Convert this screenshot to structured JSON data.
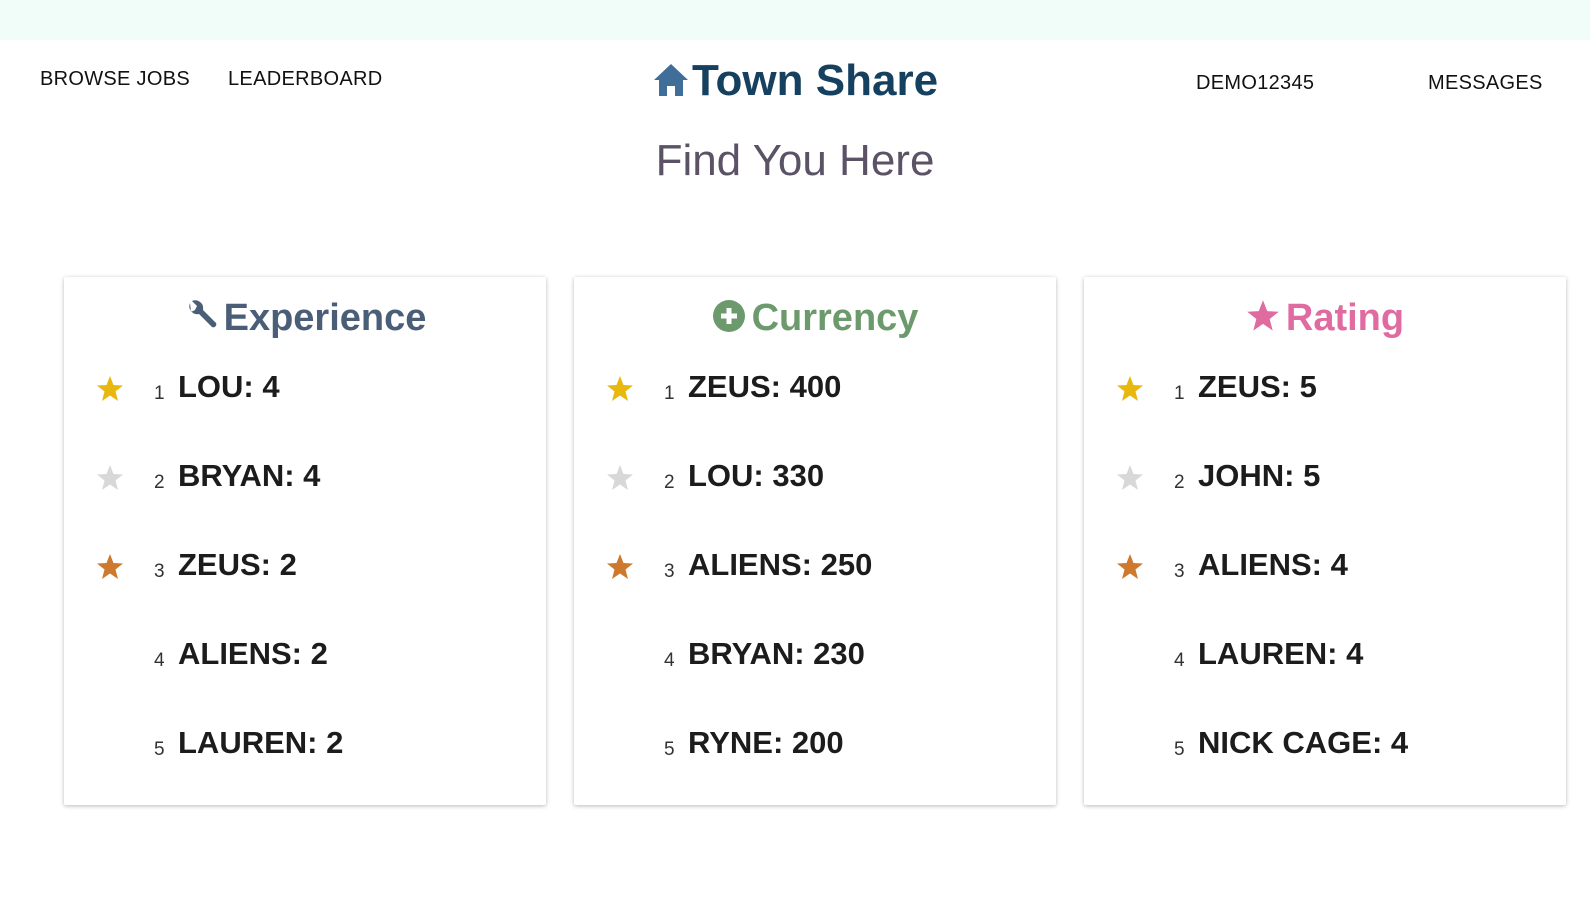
{
  "nav": {
    "browse_jobs": "BROWSE JOBS",
    "leaderboard": "LEADERBOARD",
    "user": "DEMO12345",
    "messages": "MESSAGES"
  },
  "brand": {
    "title": "Town Share",
    "icon": "home-icon"
  },
  "subtitle": "Find You Here",
  "colors": {
    "topbar": "#f1fdf8",
    "brand": "#16405f",
    "experience": "#4a5e78",
    "currency": "#6d9a6d",
    "rating": "#e06ba0",
    "gold": "#e8b80f",
    "silver": "#d8d8d8",
    "bronze": "#cd7a2e"
  },
  "leaderboards": {
    "experience": {
      "title": "Experience",
      "icon": "wrench-icon",
      "entries": [
        {
          "rank": "1",
          "text": "LOU: 4",
          "medal": "gold"
        },
        {
          "rank": "2",
          "text": "BRYAN: 4",
          "medal": "silver"
        },
        {
          "rank": "3",
          "text": "ZEUS: 2",
          "medal": "bronze"
        },
        {
          "rank": "4",
          "text": "ALIENS: 2"
        },
        {
          "rank": "5",
          "text": "LAUREN: 2"
        }
      ]
    },
    "currency": {
      "title": "Currency",
      "icon": "plus-circle-icon",
      "entries": [
        {
          "rank": "1",
          "text": "ZEUS: 400",
          "medal": "gold"
        },
        {
          "rank": "2",
          "text": "LOU: 330",
          "medal": "silver"
        },
        {
          "rank": "3",
          "text": "ALIENS: 250",
          "medal": "bronze"
        },
        {
          "rank": "4",
          "text": "BRYAN: 230"
        },
        {
          "rank": "5",
          "text": "RYNE: 200"
        }
      ]
    },
    "rating": {
      "title": "Rating",
      "icon": "star-icon",
      "entries": [
        {
          "rank": "1",
          "text": "ZEUS: 5",
          "medal": "gold"
        },
        {
          "rank": "2",
          "text": "JOHN: 5",
          "medal": "silver"
        },
        {
          "rank": "3",
          "text": "ALIENS: 4",
          "medal": "bronze"
        },
        {
          "rank": "4",
          "text": "LAUREN: 4"
        },
        {
          "rank": "5",
          "text": "NICK CAGE: 4"
        }
      ]
    }
  }
}
